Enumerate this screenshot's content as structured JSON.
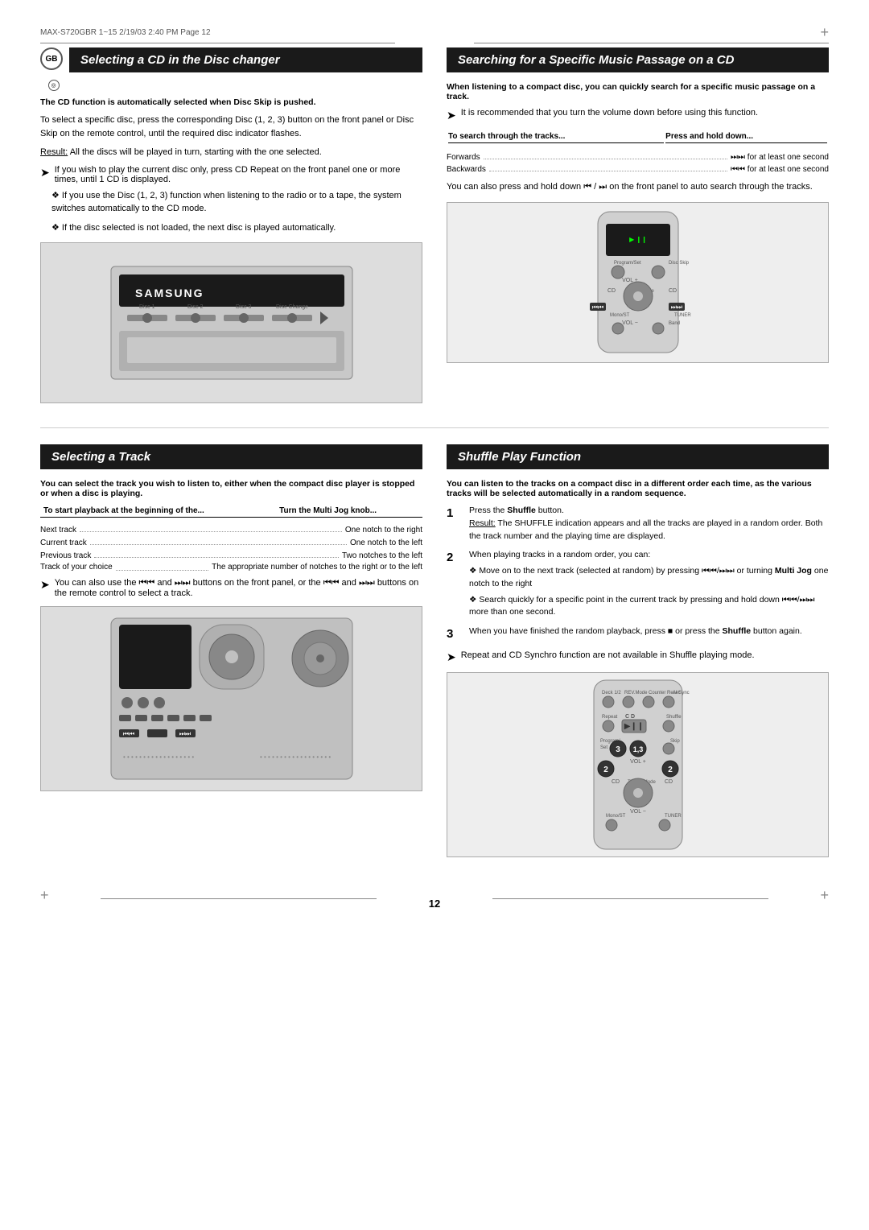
{
  "header": {
    "meta": "MAX-S720GBR  1~15   2/19/03  2:40 PM   Page 12"
  },
  "left_top": {
    "title": "Selecting a CD in the Disc changer",
    "bold_intro": "The CD function is automatically selected when Disc Skip is pushed.",
    "para1": "To select a specific disc, press the corresponding Disc (1, 2, 3) button on the front panel or Disc Skip on the remote control, until the required disc indicator flashes.",
    "result_label": "Result:",
    "result_text": "All the discs will be played in turn, starting with the one selected.",
    "note1": "If you wish to play the current disc only, press CD Repeat on the front panel one or more times, until 1 CD is displayed.",
    "note2_intro": "❖ If you use the Disc (1, 2, 3) function when listening to the radio or to a tape, the system switches automatically to the CD mode.",
    "note3": "❖ If the disc selected is not loaded, the next disc is played automatically.",
    "image_label": "Samsung Disc Changer Front Panel"
  },
  "right_top": {
    "title": "Searching for a Specific Music Passage on a CD",
    "bold_intro": "When listening to a compact disc, you can quickly search for a specific music passage on a track.",
    "note1": "It is recommended that you turn the volume down before using this function.",
    "search_table": {
      "col1": "To search through the tracks...",
      "col2": "Press and hold down...",
      "rows": [
        {
          "direction": "Forwards",
          "action": "⏭  for at least one second"
        },
        {
          "direction": "Backwards",
          "action": "⏮  for at least one second"
        }
      ]
    },
    "auto_search_text": "You can also press and hold down ⏮ / ⏭  on the front panel to auto search through the tracks.",
    "image_label": "Remote Control - Search"
  },
  "left_bottom": {
    "title": "Selecting a Track",
    "bold_intro": "You can select the track you wish to listen to, either when the compact disc player is stopped or when a disc is playing.",
    "table": {
      "col1": "To start playback at the beginning of the...",
      "col2": "Turn the Multi Jog knob...",
      "rows": [
        {
          "item": "Next track",
          "action": "One notch to the right"
        },
        {
          "item": "Current track",
          "action": "One notch to the left"
        },
        {
          "item": "Previous track",
          "action": "Two notches to the left"
        },
        {
          "item": "Track of your choice",
          "action": "The appropriate number of notches to the right or to the left"
        }
      ]
    },
    "note1": "You can also use the ⏮⏮ and ⏭⏭ buttons on the front panel, or the ⏮⏮ and ⏭⏭ buttons on the remote control to select a track.",
    "image_label": "Front Panel - Track Selection"
  },
  "right_bottom": {
    "title": "Shuffle Play Function",
    "bold_intro": "You can listen to the tracks on a compact disc in a different order each time, as the various tracks will be selected automatically in a random sequence.",
    "steps": [
      {
        "num": "1",
        "main": "Press the Shuffle button.",
        "result_label": "Result:",
        "result_text": "The SHUFFLE indication appears and all the tracks are played in a random order. Both the track number and the playing time are displayed."
      },
      {
        "num": "2",
        "main": "When playing tracks in a random order, you can:",
        "sub": [
          "❖ Move on to the next track (selected at random) by pressing ⏮⏮/⏭⏭ or turning Multi Jog one notch to the right",
          "❖ Search quickly for a specific point in the current track by pressing and hold down ⏮⏮/⏭⏭ more than one second."
        ]
      },
      {
        "num": "3",
        "main": "When you have finished the random playback, press ■ or press the Shuffle button again."
      }
    ],
    "note1": "Repeat and CD Synchro function are not available in Shuffle playing mode.",
    "image_label": "Remote Control - Shuffle"
  },
  "page_number": "12"
}
